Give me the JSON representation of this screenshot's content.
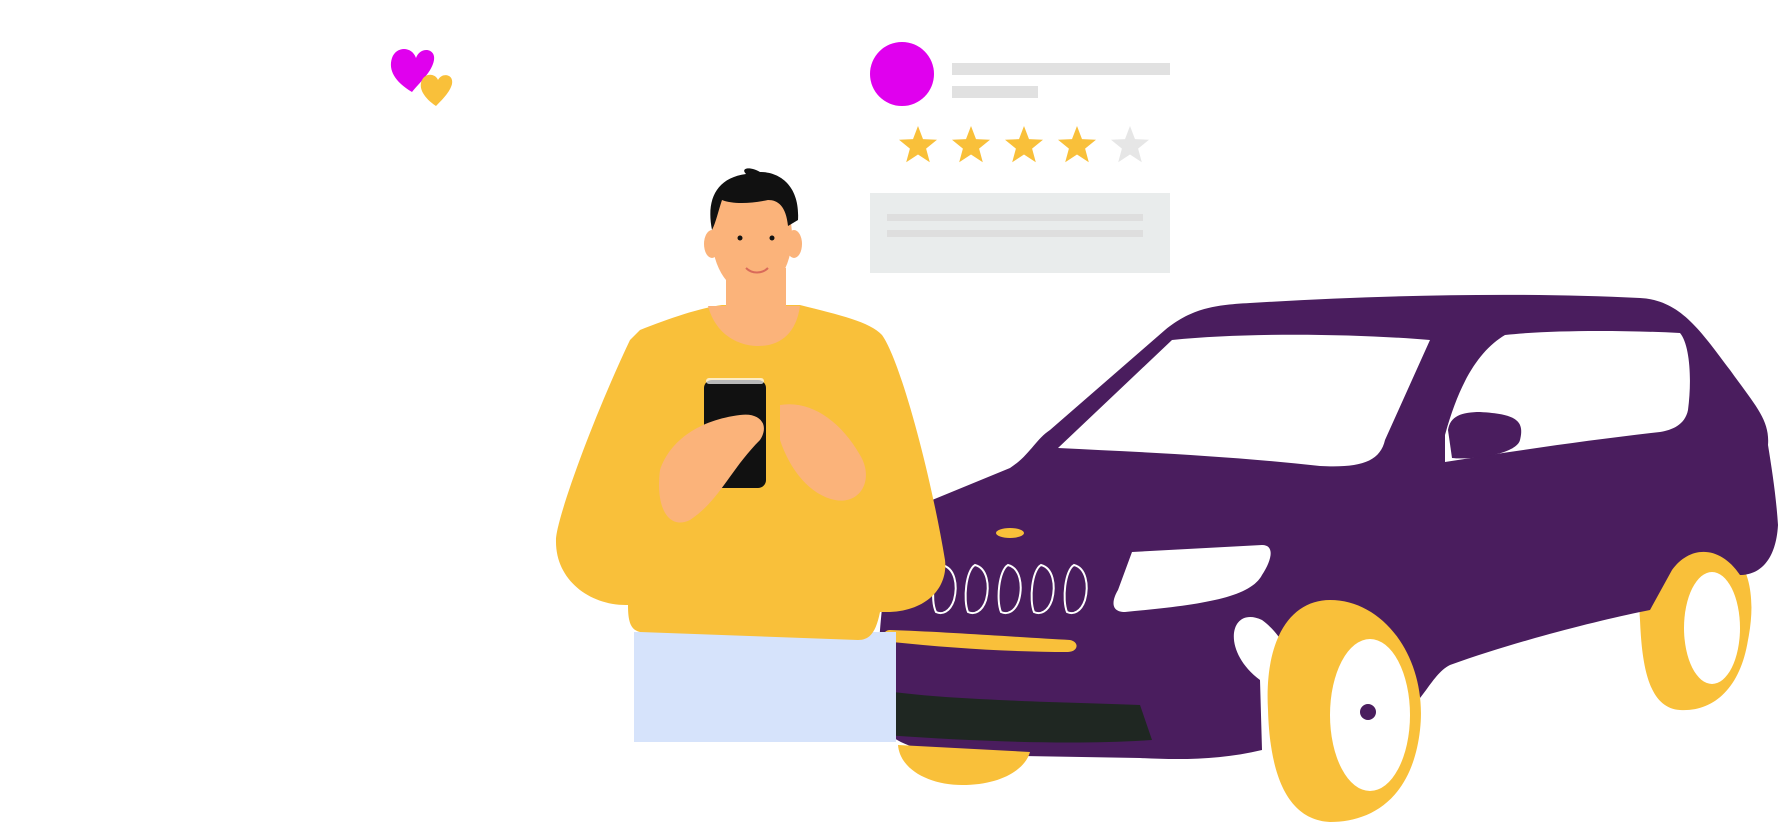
{
  "scene": {
    "background": "#ffffff",
    "description_icons": [
      "heart-icon",
      "star-icon",
      "smartphone-icon",
      "car-icon",
      "avatar-icon"
    ]
  },
  "colors": {
    "magenta": "#e000ee",
    "yellow": "#f9c03a",
    "purple": "#4a1d5e",
    "dark_trim": "#1f2722",
    "placeholder_gray": "#e1e1e1",
    "card_bg": "#e9ecec",
    "skin": "#fbb37a",
    "hair": "#111111",
    "pants": "#d6e3fb",
    "empty_star": "#e6e6e6"
  },
  "review_card": {
    "rating": 4,
    "max_rating": 5
  }
}
